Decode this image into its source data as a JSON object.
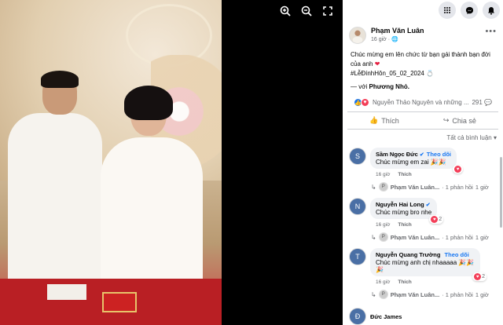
{
  "viewer": {
    "zoom_in_icon": "zoom-in",
    "zoom_out_icon": "zoom-out",
    "fullscreen_icon": "expand"
  },
  "post": {
    "author": "Phạm Văn Luân",
    "time": "16 giờ",
    "caption_line1": "Chúc mừng em lên chức từ bạn gái thành bạn đời của anh",
    "hashtag": "#LễĐínhHôn_05_02_2024",
    "with_prefix": "— với",
    "with_name": "Phương Nhỏ."
  },
  "reactions": {
    "names": "Nguyễn Thảo Nguyên và những ...",
    "count": "291"
  },
  "actions": {
    "like": "Thích",
    "share": "Chia sẻ"
  },
  "sort_label": "Tất cả bình luận",
  "comments": [
    {
      "author": "Sầm Ngọc Đức",
      "follow": "Theo dõi",
      "text": "Chúc mừng em zai 🎉🎉",
      "time": "16 giờ",
      "like": "Thích",
      "reply_author": "Phạm Văn Luân...",
      "reply_count": "· 1 phản hồi",
      "reply_time": "1 giờ"
    },
    {
      "author": "Nguyễn Hai Long",
      "follow": "",
      "text": "Chúc mừng bro nhe",
      "time": "16 giờ",
      "like": "Thích",
      "react_count": "2",
      "reply_author": "Phạm Văn Luân...",
      "reply_count": "· 1 phản hồi",
      "reply_time": "1 giờ"
    },
    {
      "author": "Nguyễn Quang Trường",
      "follow": "Theo dõi",
      "text": "Chúc mừng anh chị nhaaaaa 🎉🎉🎉",
      "time": "16 giờ",
      "like": "Thích",
      "react_count": "2",
      "reply_author": "Phạm Văn Luân...",
      "reply_count": "· 1 phản hồi",
      "reply_time": "1 giờ"
    },
    {
      "author": "Đức James"
    }
  ],
  "colors": {
    "accent": "#1877f2",
    "love": "#f33e58"
  }
}
